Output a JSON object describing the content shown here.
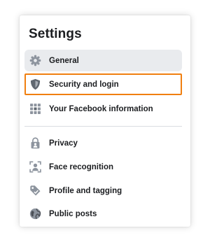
{
  "settings": {
    "title": "Settings",
    "items": [
      {
        "label": "General",
        "icon": "gear-icon"
      },
      {
        "label": "Security and login",
        "icon": "shield-icon"
      },
      {
        "label": "Your Facebook information",
        "icon": "grid-icon"
      },
      {
        "label": "Privacy",
        "icon": "lock-person-icon"
      },
      {
        "label": "Face recognition",
        "icon": "face-scan-icon"
      },
      {
        "label": "Profile and tagging",
        "icon": "tag-icon"
      },
      {
        "label": "Public posts",
        "icon": "globe-icon"
      }
    ],
    "selected_item": "General",
    "highlighted_item": "Security and login"
  },
  "colors": {
    "selected_background": "#e9ebee",
    "highlight_border": "#f07f10",
    "text": "#1c1e21",
    "icon_gray": "#606770",
    "icon_accent": "#8d949e",
    "divider": "#dadde1"
  }
}
